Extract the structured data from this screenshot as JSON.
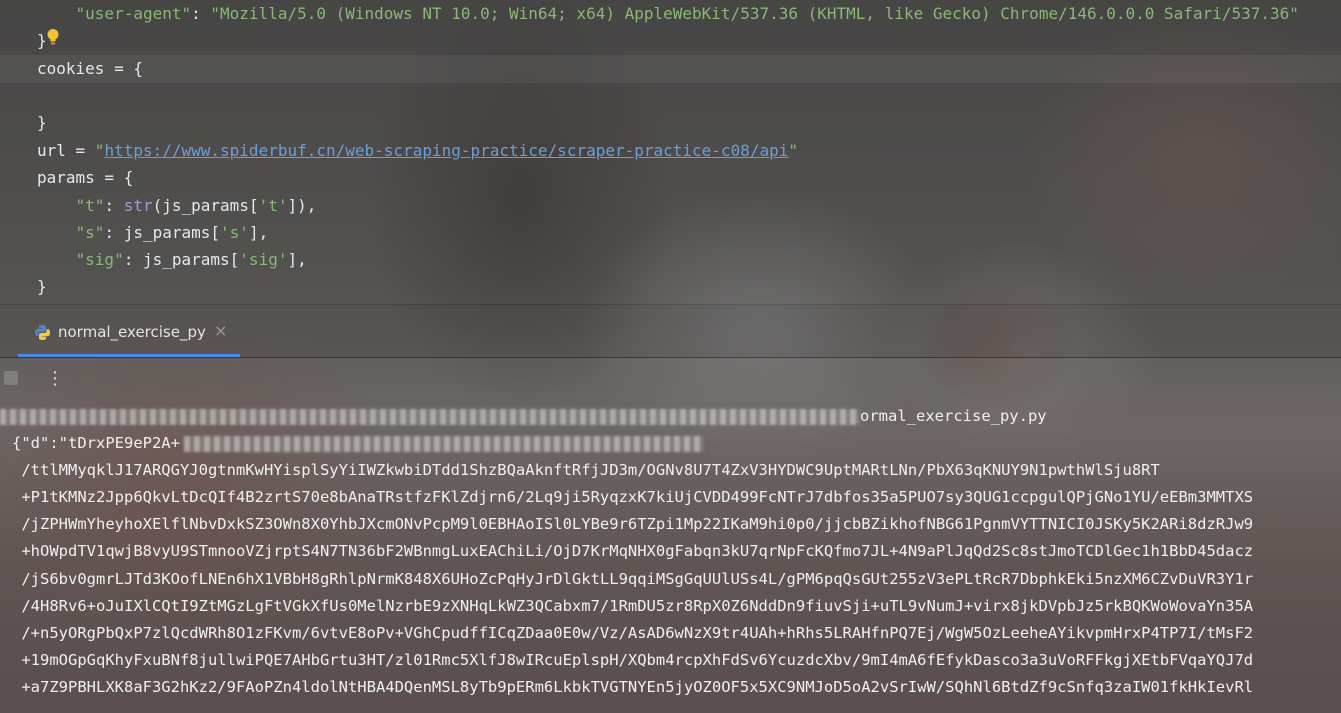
{
  "editor": {
    "lines": [
      {
        "indent": "    ",
        "segments": [
          {
            "cls": "str",
            "text": "\"user-agent\""
          },
          {
            "cls": "punc",
            "text": ": "
          },
          {
            "cls": "str",
            "text": "\"Mozilla/5.0 (Windows NT 10.0; Win64; x64) AppleWebKit/537.36 (KHTML, like Gecko) Chrome/146.0.0.0 Safari/537.36\""
          }
        ]
      },
      {
        "indent": "",
        "segments": [
          {
            "cls": "punc",
            "text": "}"
          }
        ]
      },
      {
        "indent": "",
        "segments": [
          {
            "cls": "punc",
            "text": "cookies = {"
          }
        ]
      },
      {
        "indent": "",
        "segments": [
          {
            "cls": "punc",
            "text": ""
          }
        ]
      },
      {
        "indent": "",
        "segments": [
          {
            "cls": "punc",
            "text": "}"
          }
        ]
      },
      {
        "indent": "",
        "segments": [
          {
            "cls": "punc",
            "text": "url = "
          },
          {
            "cls": "str",
            "text": "\""
          },
          {
            "cls": "link",
            "text": "https://www.spiderbuf.cn/web-scraping-practice/scraper-practice-c08/api"
          },
          {
            "cls": "str",
            "text": "\""
          }
        ]
      },
      {
        "indent": "",
        "segments": [
          {
            "cls": "punc",
            "text": "params = {"
          }
        ]
      },
      {
        "indent": "    ",
        "segments": [
          {
            "cls": "str",
            "text": "\"t\""
          },
          {
            "cls": "punc",
            "text": ": "
          },
          {
            "cls": "fn",
            "text": "str"
          },
          {
            "cls": "punc",
            "text": "(js_params["
          },
          {
            "cls": "str",
            "text": "'t'"
          },
          {
            "cls": "punc",
            "text": "]),"
          }
        ]
      },
      {
        "indent": "    ",
        "segments": [
          {
            "cls": "str",
            "text": "\"s\""
          },
          {
            "cls": "punc",
            "text": ": js_params["
          },
          {
            "cls": "str",
            "text": "'s'"
          },
          {
            "cls": "punc",
            "text": "],"
          }
        ]
      },
      {
        "indent": "    ",
        "segments": [
          {
            "cls": "str",
            "text": "\"sig\""
          },
          {
            "cls": "punc",
            "text": ": js_params["
          },
          {
            "cls": "str",
            "text": "'sig'"
          },
          {
            "cls": "punc",
            "text": "],"
          }
        ]
      },
      {
        "indent": "",
        "segments": [
          {
            "cls": "punc",
            "text": "}"
          }
        ]
      }
    ]
  },
  "run_panel": {
    "tab_label": "normal_exercise_py",
    "close_glyph": "×",
    "more_glyph": "⋮"
  },
  "console": {
    "command_line_visible_tail": "ormal_exercise_py.py",
    "output_lines": [
      "{\"d\":\"tDrxPE9eP2A+",
      " /ttlMMyqklJ17ARQGYJ0gtnmKwHYisplSyYiIWZkwbiDTdd1ShzBQaAknftRfjJD3m/OGNv8U7T4ZxV3HYDWC9UptMARtLNn/PbX63qKNUY9N1pwthWlSju8RT",
      " +P1tKMNz2Jpp6QkvLtDcQIf4B2zrtS70e8bAnaTRstfzFKlZdjrn6/2Lq9ji5RyqzxK7kiUjCVDD499FcNTrJ7dbfos35a5PUO7sy3QUG1ccpgulQPjGNo1YU/eEBm3MMTXS",
      " /jZPHWmYheyhoXElflNbvDxkSZ3OWn8X0YhbJXcmONvPcpM9l0EBHAoISl0LYBe9r6TZpi1Mp22IKaM9hi0p0/jjcbBZikhofNBG61PgnmVYTTNICI0JSKy5K2ARi8dzRJw9",
      " +hOWpdTV1qwjB8vyU9STmnooVZjrptS4N7TN36bF2WBnmgLuxEAChiLi/OjD7KrMqNHX0gFabqn3kU7qrNpFcKQfmo7JL+4N9aPlJqQd2Sc8stJmoTCDlGec1h1BbD45dacz",
      " /jS6bv0gmrLJTd3KOofLNEn6hX1VBbH8gRhlpNrmK848X6UHoZcPqHyJrDlGktLL9qqiMSgGqUUlUSs4L/gPM6pqQsGUt255zV3ePLtRcR7DbphkEki5nzXM6CZvDuVR3Y1r",
      " /4H8Rv6+oJuIXlCQtI9ZtMGzLgFtVGkXfUs0MelNzrbE9zXNHqLkWZ3QCabxm7/1RmDU5zr8RpX0Z6NddDn9fiuvSji+uTL9vNumJ+virx8jkDVpbJz5rkBQKWoWovaYn35A",
      " /+n5yORgPbQxP7zlQcdWRh8O1zFKvm/6vtvE8oPv+VGhCpudffICqZDaa0E0w/Vz/AsAD6wNzX9tr4UAh+hRhs5LRAHfnPQ7Ej/WgW5OzLeeheAYikvpmHrxP4TP7I/tMsF2",
      " +19mOGpGqKhyFxuBNf8jullwiPQE7AHbGrtu3HT/zl01Rmc5XlfJ8wIRcuEplspH/XQbm4rcpXhFdSv6YcuzdcXbv/9mI4mA6fEfykDasco3a3uVoRFFkgjXEtbFVqaYQJ7d",
      " +a7Z9PBHLXK8aF3G2hKz2/9FAoPZn4ldolNtHBA4DQenMSL8yTb9pERm6LkbkTVGTNYEn5jyOZ0OF5x5XC9NMJoD5oA2vSrIwW/SQhNl6BtdZf9cSnfq3zaIW01fkHkIevRl"
    ]
  }
}
